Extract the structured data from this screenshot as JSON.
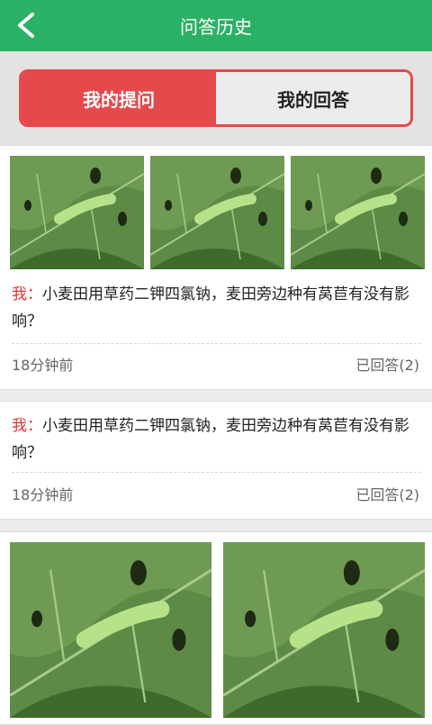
{
  "header": {
    "title": "问答历史",
    "back_icon": "chevron-left-icon"
  },
  "tabs": [
    {
      "label": "我的提问",
      "active": true
    },
    {
      "label": "我的回答",
      "active": false
    }
  ],
  "questions": [
    {
      "prefix": "我：",
      "text": "小麦田用草药二钾四氯钠，麦田旁边种有莴苣有没有影响？",
      "time": "18分钟前",
      "status": "已回答(2)",
      "photo_count": 3
    },
    {
      "prefix": "我：",
      "text": "小麦田用草药二钾四氯钠，麦田旁边种有莴苣有没有影响？",
      "time": "18分钟前",
      "status": "已回答(2)",
      "photo_count": 0
    },
    {
      "photo_count": 2
    }
  ],
  "colors": {
    "header": "#2bb165",
    "accent": "#e5494b"
  }
}
